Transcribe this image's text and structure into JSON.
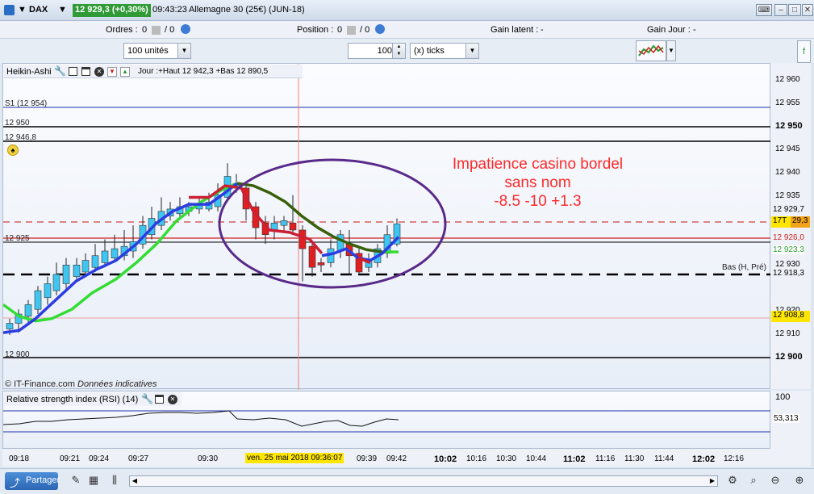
{
  "titlebar": {
    "symbol": "DAX",
    "price": "12 929,3 (+0,30%)",
    "time": "09:43:23",
    "instrument": "Allemagne 30 (25€) (JUN-18)"
  },
  "infobar": {
    "orders_label": "Ordres :",
    "orders_value": "0",
    "orders_total": "/ 0",
    "position_label": "Position :",
    "position_value": "0",
    "position_total": "/ 0",
    "gain_latent_label": "Gain latent :",
    "gain_latent_value": "-",
    "gain_jour_label": "Gain Jour :",
    "gain_jour_value": "-"
  },
  "controls": {
    "units_select": "100 unités",
    "ticks_input": "100",
    "ticks_select": "(x) ticks"
  },
  "chart_header": {
    "chart_name": "Heikin-Ashi",
    "day_info": "Jour :+Haut 12 942,3 +Bas 12 890,5"
  },
  "levels": {
    "s1": "S1 (12 954)",
    "l12950": "12 950",
    "l12946": "12 946,8",
    "l12925": "12 925",
    "l12900": "12 900",
    "bas_label": "Bas (H, Pré)"
  },
  "annotation": {
    "line1": "Impatience casino bordel",
    "line2": "sans nom",
    "line3": "-8.5 -10 +1.3"
  },
  "source": {
    "copyright": "© IT-Finance.com",
    "note": "Données indicatives"
  },
  "price_axis": {
    "ticks": [
      "12 960",
      "12 955",
      "12 945",
      "12 940",
      "12 935",
      "12 930",
      "12 920",
      "12 910",
      "12 905"
    ],
    "bold_950": "12 950",
    "bold_900": "12 900",
    "tag_9297": "12 929,7",
    "tag_17t": "17T",
    "tag_293": "29,3",
    "tag_9260": "12 926,0",
    "tag_9233": "12 923,3",
    "tag_9183": "12 918,3",
    "tag_9088": "12 908,8"
  },
  "rsi": {
    "title": "Relative strength index (RSI) (14)",
    "axis_100": "100",
    "axis_value": "53,313"
  },
  "time_axis": {
    "ticks": [
      "09:18",
      "09:21",
      "09:24",
      "09:27",
      "09:30",
      "09:39",
      "09:42",
      "10:02",
      "10:16",
      "10:30",
      "10:44",
      "11:02",
      "11:16",
      "11:30",
      "11:44",
      "12:02",
      "12:16"
    ],
    "cursor_label": "ven. 25 mai 2018 09:36:07"
  },
  "bottombar": {
    "share_label": "Partager"
  },
  "colors": {
    "up_candle": "#40c4f0",
    "down_candle": "#e02020",
    "ma_green": "#33dd33",
    "ma_dark": "#3a5f0b",
    "ma_blue": "#2b3de0",
    "ma_red": "#cc1f33",
    "ellipse": "#5a2a8a",
    "annotation": "#ff2a2a",
    "badge_green": "#2f9a36"
  }
}
